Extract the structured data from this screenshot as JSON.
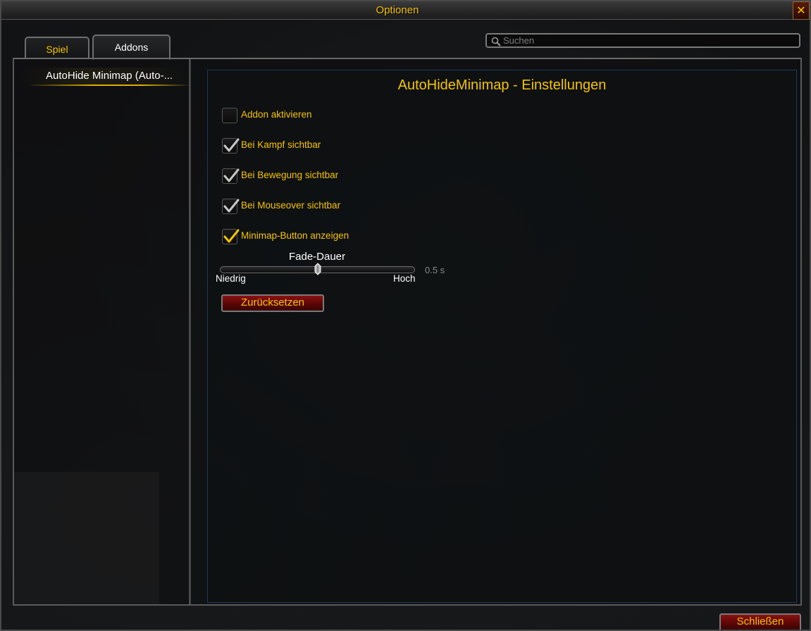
{
  "window": {
    "title": "Optionen",
    "close_glyph": "✕"
  },
  "tabs": [
    {
      "label": "Spiel"
    },
    {
      "label": "Addons"
    }
  ],
  "search": {
    "placeholder": "Suchen",
    "value": ""
  },
  "sidebar": {
    "items": [
      {
        "label": "AutoHide Minimap (Auto-..."
      }
    ]
  },
  "panel": {
    "title": "AutoHideMinimap - Einstellungen",
    "options": [
      {
        "label": "Addon aktivieren",
        "checked": false
      },
      {
        "label": "Bei Kampf sichtbar",
        "checked": true
      },
      {
        "label": "Bei Bewegung sichtbar",
        "checked": true
      },
      {
        "label": "Bei Mouseover sichtbar",
        "checked": true
      },
      {
        "label": "Minimap-Button anzeigen",
        "checked": true
      }
    ],
    "slider": {
      "title": "Fade-Dauer",
      "low_label": "Niedrig",
      "high_label": "Hoch",
      "value_text": "0.5 s",
      "position_fraction": 0.5
    },
    "reset_label": "Zurücksetzen"
  },
  "footer": {
    "close_label": "Schließen"
  },
  "colors": {
    "accent_gold": "#f5c400",
    "button_red": "#8c1010",
    "panel_border_blue": "#1e3a5c",
    "check_grey": "#c8c8c8",
    "check_gold": "#f5c400"
  },
  "icons": {
    "search": "magnifier-icon",
    "close": "close-x-icon",
    "check": "checkmark-icon",
    "slider_thumb": "slider-thumb-icon"
  }
}
